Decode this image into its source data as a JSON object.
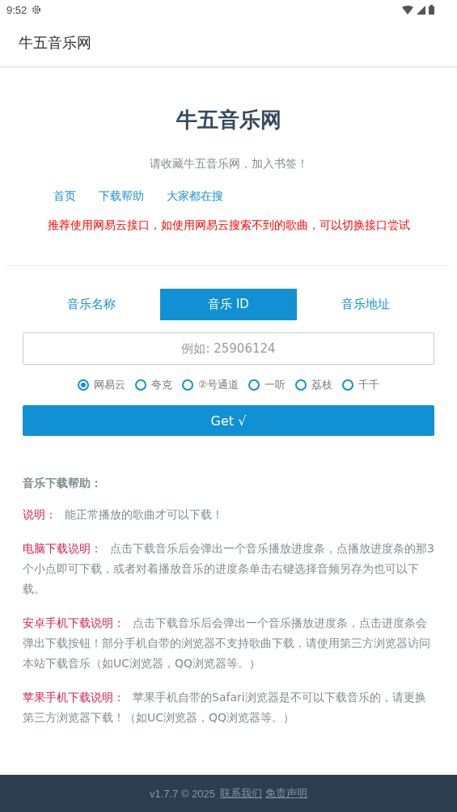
{
  "status_bar": {
    "time": "9:52"
  },
  "app_bar": {
    "title": "牛五音乐网"
  },
  "header": {
    "title": "牛五音乐网",
    "subtitle": "请收藏牛五音乐网，加入书签！",
    "links": [
      "首页",
      "下载帮助",
      "大家都在搜"
    ],
    "notice": "推荐使用网易云接口，如使用网易云搜索不到的歌曲，可以切换接口尝试"
  },
  "tabs": [
    {
      "label": "音乐名称",
      "selected": false
    },
    {
      "label": "音乐 ID",
      "selected": true
    },
    {
      "label": "音乐地址",
      "selected": false
    }
  ],
  "search": {
    "placeholder": "例如: 25906124"
  },
  "sources": [
    {
      "label": "网易云",
      "selected": true
    },
    {
      "label": "夸克",
      "selected": false
    },
    {
      "label": "②号通道",
      "selected": false
    },
    {
      "label": "一听",
      "selected": false
    },
    {
      "label": "荔枝",
      "selected": false
    },
    {
      "label": "千千",
      "selected": false
    }
  ],
  "get_button": "Get √",
  "help": {
    "title": "音乐下载帮助：",
    "items": [
      {
        "label": "说明：",
        "text": "能正常播放的歌曲才可以下载！"
      },
      {
        "label": "电脑下载说明：",
        "text": "点击下载音乐后会弹出一个音乐播放进度条，点播放进度条的那3个小点即可下载，或者对着播放音乐的进度条单击右键选择音频另存为也可以下载。"
      },
      {
        "label": "安卓手机下载说明：",
        "text": "点击下载音乐后会弹出一个音乐播放进度条，点击进度条会弹出下载按钮！部分手机自带的浏览器不支持歌曲下载，请使用第三方浏览器访问本站下载音乐（如UC浏览器，QQ浏览器等。）"
      },
      {
        "label": "苹果手机下载说明：",
        "text": "苹果手机自带的Safari浏览器是不可以下载音乐的，请更换第三方浏览器下载！（如UC浏览器，QQ浏览器等。）"
      }
    ]
  },
  "footer": {
    "version": "v1.7.7 © 2025",
    "links": [
      "联系我们",
      "免责声明"
    ]
  }
}
